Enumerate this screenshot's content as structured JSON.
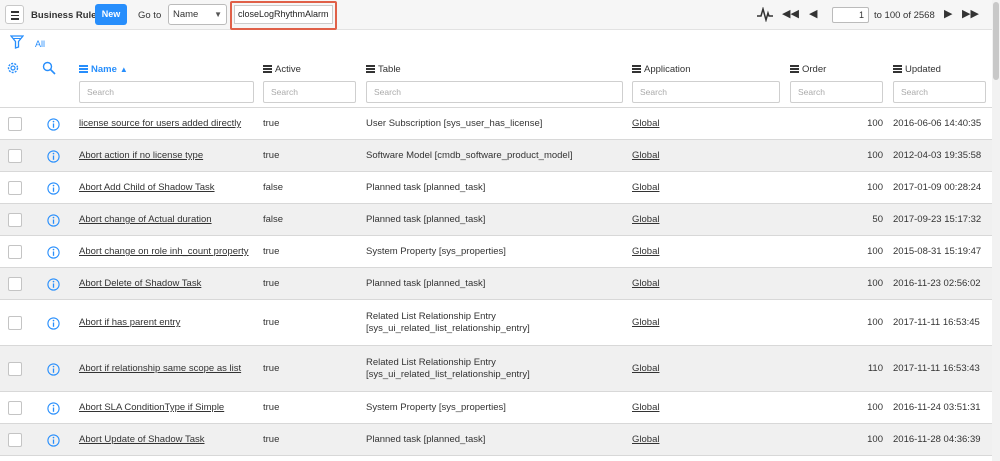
{
  "toolbar": {
    "title": "Business Rules",
    "new_label": "New",
    "goto_label": "Go to",
    "goto_select_value": "Name",
    "search_value": "closeLogRhythmAlarm",
    "page_value": "1",
    "page_of": "to 100 of 2568"
  },
  "filter": {
    "all_label": "All"
  },
  "columns": [
    {
      "label": "Name",
      "sorted": true
    },
    {
      "label": "Active"
    },
    {
      "label": "Table"
    },
    {
      "label": "Application"
    },
    {
      "label": "Order"
    },
    {
      "label": "Updated"
    }
  ],
  "search_placeholder": "Search",
  "rows": [
    {
      "name": "license source for users added directly",
      "active": "true",
      "table": [
        "User Subscription [sys_user_has_license]"
      ],
      "app": "Global",
      "order": "100",
      "updated": "2016-06-06 14:40:35"
    },
    {
      "name": "Abort action if no license type",
      "active": "true",
      "table": [
        "Software Model [cmdb_software_product_model]"
      ],
      "app": "Global",
      "order": "100",
      "updated": "2012-04-03 19:35:58"
    },
    {
      "name": "Abort Add Child of Shadow Task",
      "active": "false",
      "table": [
        "Planned task [planned_task]"
      ],
      "app": "Global",
      "order": "100",
      "updated": "2017-01-09 00:28:24"
    },
    {
      "name": "Abort change of Actual duration",
      "active": "false",
      "table": [
        "Planned task [planned_task]"
      ],
      "app": "Global",
      "order": "50",
      "updated": "2017-09-23 15:17:32"
    },
    {
      "name": "Abort change on role inh_count property",
      "active": "true",
      "table": [
        "System Property [sys_properties]"
      ],
      "app": "Global",
      "order": "100",
      "updated": "2015-08-31 15:19:47"
    },
    {
      "name": "Abort Delete of Shadow Task",
      "active": "true",
      "table": [
        "Planned task [planned_task]"
      ],
      "app": "Global",
      "order": "100",
      "updated": "2016-11-23 02:56:02"
    },
    {
      "name": "Abort if has parent entry",
      "active": "true",
      "table": [
        "Related List Relationship Entry",
        "[sys_ui_related_list_relationship_entry]"
      ],
      "app": "Global",
      "order": "100",
      "updated": "2017-11-11 16:53:45"
    },
    {
      "name": "Abort if relationship same scope as list",
      "active": "true",
      "table": [
        "Related List Relationship Entry",
        "[sys_ui_related_list_relationship_entry]"
      ],
      "app": "Global",
      "order": "110",
      "updated": "2017-11-11 16:53:43"
    },
    {
      "name": "Abort SLA ConditionType if Simple",
      "active": "true",
      "table": [
        "System Property [sys_properties]"
      ],
      "app": "Global",
      "order": "100",
      "updated": "2016-11-24 03:51:31"
    },
    {
      "name": "Abort Update of Shadow Task",
      "active": "true",
      "table": [
        "Planned task [planned_task]"
      ],
      "app": "Global",
      "order": "100",
      "updated": "2016-11-28 04:36:39"
    }
  ]
}
